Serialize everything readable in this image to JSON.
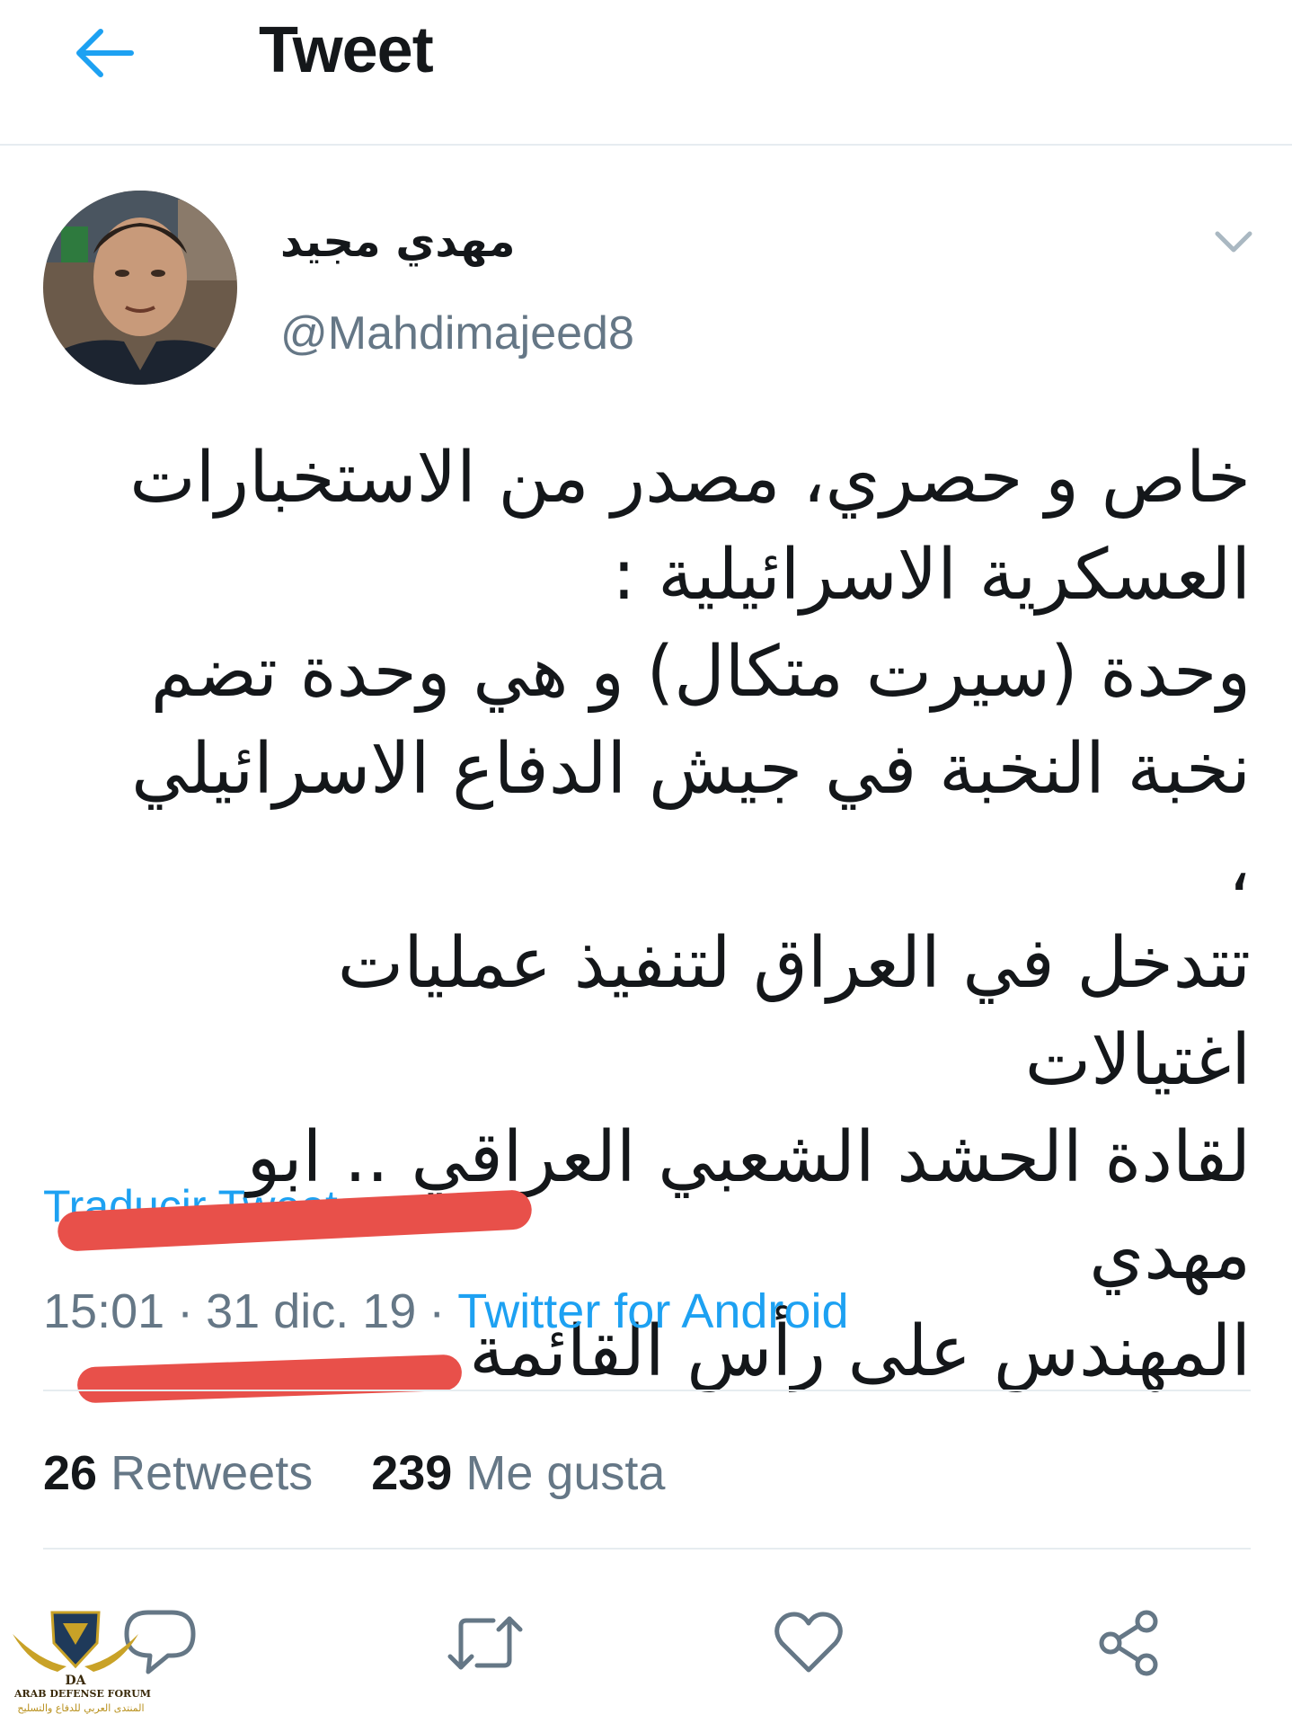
{
  "header": {
    "title": "Tweet",
    "back_icon": "back-arrow-icon"
  },
  "author": {
    "display_name": "مهدي مجيد",
    "handle": "@Mahdimajeed8"
  },
  "tweet": {
    "text": "خاص و حصري، مصدر من الاستخبارات\nالعسكرية الاسرائيلية :\nوحدة (سيرت متكال) و هي وحدة تضم\nنخبة النخبة في جيش الدفاع الاسرائيلي ،\nتتدخل في العراق لتنفيذ عمليات اغتيالات\nلقادة الحشد الشعبي العراقي .. ابو مهدي\nالمهندس على رأس القائمة .",
    "translate_label": "Traducir Tweet",
    "time": "15:01",
    "date": "31 dic. 19",
    "separator": "·",
    "source": "Twitter for Android"
  },
  "stats": {
    "retweets_count": "26",
    "retweets_label": "Retweets",
    "likes_count": "239",
    "likes_label": "Me gusta"
  },
  "actions": [
    "reply-icon",
    "retweet-icon",
    "like-icon",
    "share-icon"
  ],
  "watermark": {
    "logo_text": "DA",
    "line1": "ARAB DEFENSE FORUM",
    "line2": "المنتدى العربي للدفاع والتسليح"
  },
  "colors": {
    "accent": "#1da1f2",
    "text": "#14171a",
    "secondary": "#657786",
    "divider": "#e6ecf0",
    "annotation": "#e8504a"
  }
}
